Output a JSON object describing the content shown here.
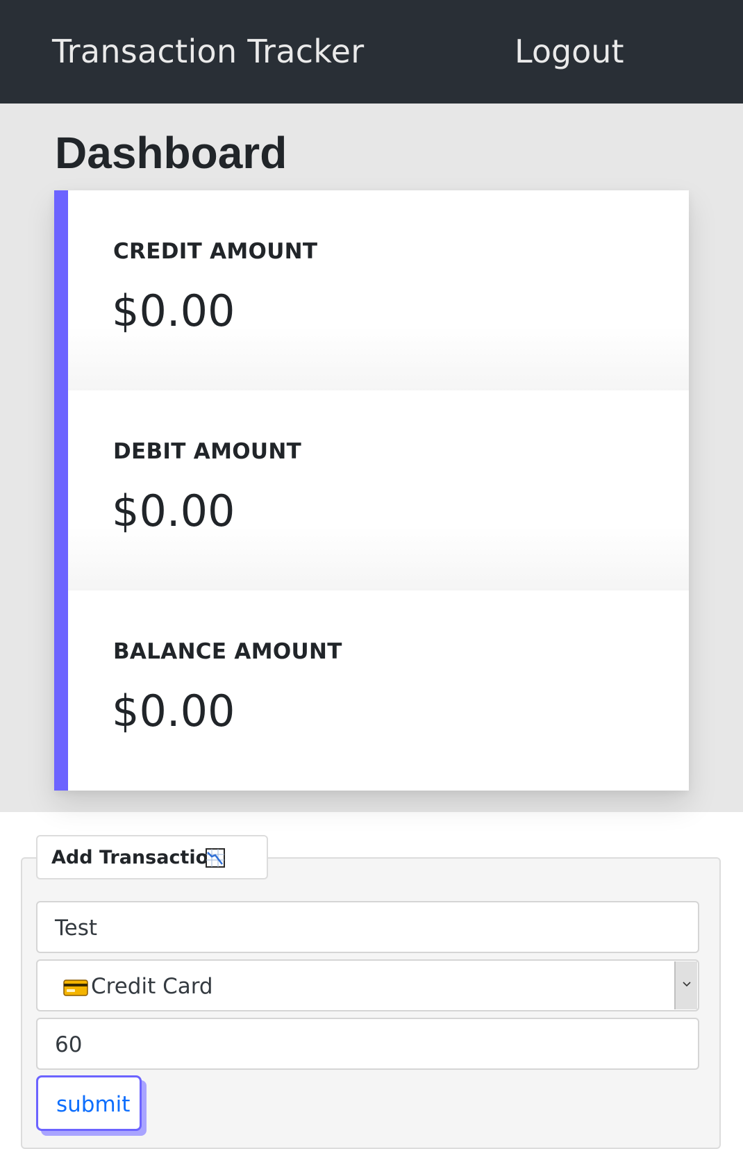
{
  "navbar": {
    "brand": "Transaction Tracker",
    "logout_label": "Logout"
  },
  "dashboard": {
    "title": "Dashboard",
    "accent_color": "#6c63ff",
    "stats": [
      {
        "label": "CREDIT AMOUNT",
        "value": "$0.00"
      },
      {
        "label": "DEBIT AMOUNT",
        "value": "$0.00"
      },
      {
        "label": "BALANCE AMOUNT",
        "value": "$0.00"
      }
    ]
  },
  "form": {
    "legend": "Add Transaction",
    "legend_icon": "chart-decreasing-icon",
    "description_value": "Test",
    "type_select": {
      "selected_label": "Credit Card",
      "icon": "credit-card-icon"
    },
    "amount_value": "60",
    "submit_label": "submit"
  }
}
